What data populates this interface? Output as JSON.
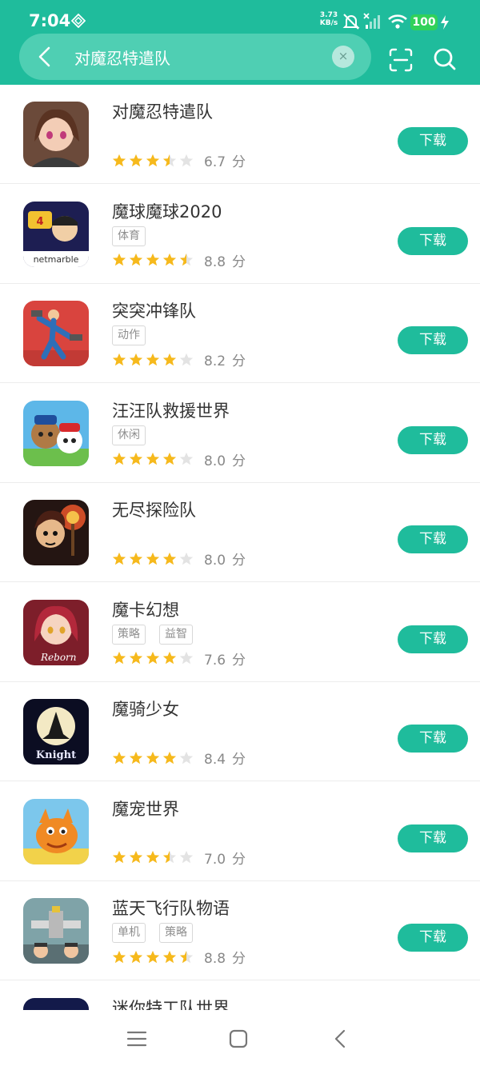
{
  "status_bar": {
    "time": "7:04",
    "net_speed_value": "3.73",
    "net_speed_unit": "KB/s",
    "battery": "100"
  },
  "search": {
    "query": "对魔忍特遣队",
    "clear_symbol": "×"
  },
  "colors": {
    "brand": "#1fbc9c",
    "star_filled": "#f6b91c",
    "star_empty": "#e3e3e3"
  },
  "download_label": "下载",
  "score_unit": "分",
  "apps": [
    {
      "name": "对魔忍特遣队",
      "tags": [],
      "rating": 3.5,
      "score": "6.7",
      "icon": "anime-girl-icon"
    },
    {
      "name": "魔球魔球2020",
      "tags": [
        "体育"
      ],
      "rating": 4.5,
      "score": "8.8",
      "icon": "netmarble-baseball-icon"
    },
    {
      "name": "突突冲锋队",
      "tags": [
        "动作"
      ],
      "rating": 4,
      "score": "8.2",
      "icon": "stick-runner-icon"
    },
    {
      "name": "汪汪队救援世界",
      "tags": [
        "休闲"
      ],
      "rating": 4,
      "score": "8.0",
      "icon": "paw-patrol-icon"
    },
    {
      "name": "无尽探险队",
      "tags": [],
      "rating": 4,
      "score": "8.0",
      "icon": "torch-adventurer-icon"
    },
    {
      "name": "魔卡幻想",
      "tags": [
        "策略",
        "益智"
      ],
      "rating": 4,
      "score": "7.6",
      "icon": "reborn-girl-icon"
    },
    {
      "name": "魔骑少女",
      "tags": [],
      "rating": 4,
      "score": "8.4",
      "icon": "witchs-knight-icon"
    },
    {
      "name": "魔宠世界",
      "tags": [],
      "rating": 3.5,
      "score": "7.0",
      "icon": "orange-dragon-icon"
    },
    {
      "name": "蓝天飞行队物语",
      "tags": [
        "单机",
        "策略"
      ],
      "rating": 4.5,
      "score": "8.8",
      "icon": "pixel-airplane-icon"
    },
    {
      "name": "迷你特工队世界",
      "tags": [],
      "rating": 0,
      "score": "",
      "icon": "mini-agent-icon"
    }
  ]
}
